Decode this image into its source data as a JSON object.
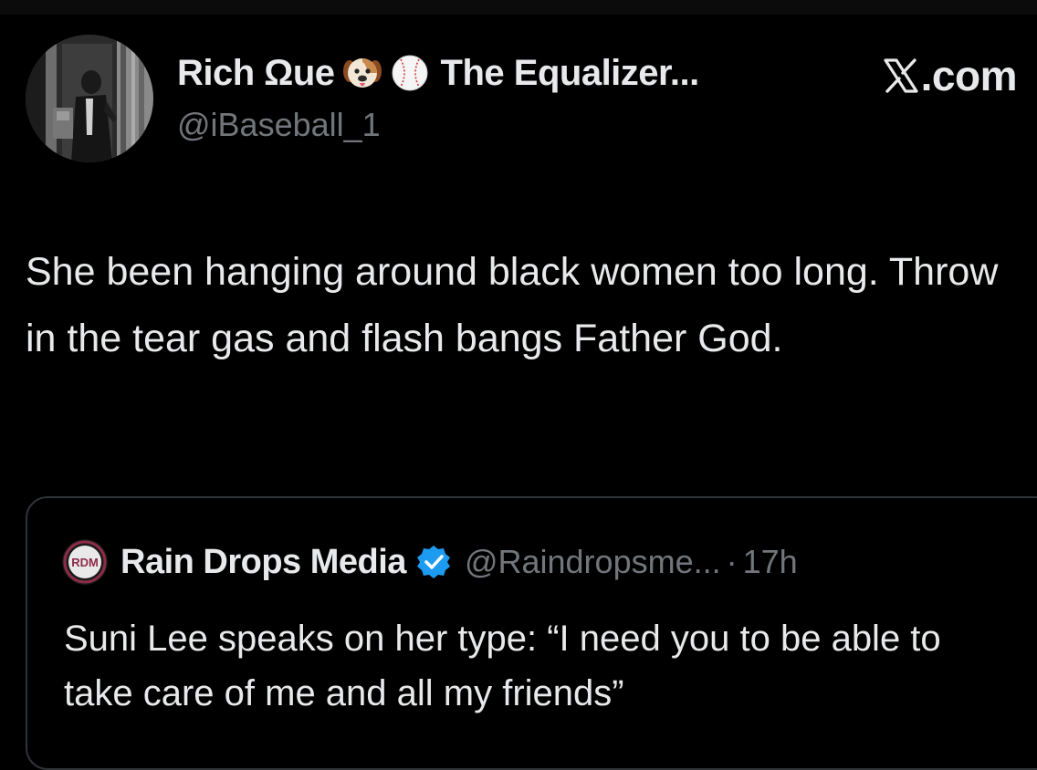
{
  "post": {
    "author": {
      "display_name": "Rich Ωue",
      "affiliation": "The Equalizer...",
      "handle": "@iBaseball_1",
      "badges": [
        "dog-face-emoji",
        "baseball-emoji"
      ],
      "avatar": "profile-photo"
    },
    "source_label": ".com",
    "source_icon": "x-logo",
    "text": "She been hanging around black women too long. Throw in the tear gas and flash bangs Father God."
  },
  "quoted_post": {
    "author": {
      "display_name": "Rain Drops Media",
      "handle": "@Raindropsme...",
      "avatar_label": "RDM",
      "verified": true
    },
    "separator": "·",
    "time": "17h",
    "text": "Suni Lee speaks on her type: “I need you to be able to take care of me and all my friends”"
  },
  "colors": {
    "background": "#000000",
    "primary_text": "#e7e9ea",
    "secondary_text": "#71767b",
    "border": "#2f3336",
    "verified_blue": "#1d9bf0"
  }
}
